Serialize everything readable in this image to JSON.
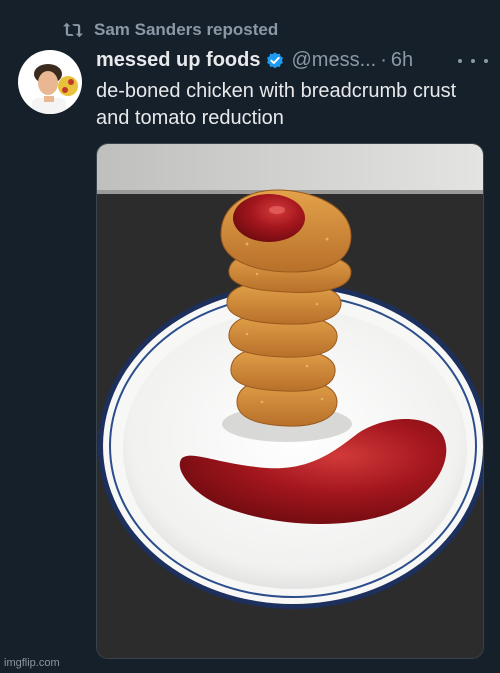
{
  "repost": {
    "text": "Sam Sanders reposted",
    "icon": "repost-icon"
  },
  "tweet": {
    "display_name": "messed up foods",
    "verified": true,
    "handle": "@mess...",
    "separator": "·",
    "time": "6h",
    "text": "de-boned chicken with breadcrumb crust and tomato reduction",
    "media": {
      "type": "photo",
      "depicts": "stack of chicken nuggets with ketchup on a white plate"
    }
  },
  "watermark": "imgflip.com",
  "colors": {
    "background": "#15202b",
    "primary_text": "#e7e9ea",
    "secondary_text": "#8b98a5",
    "verified": "#1d9bf0"
  }
}
